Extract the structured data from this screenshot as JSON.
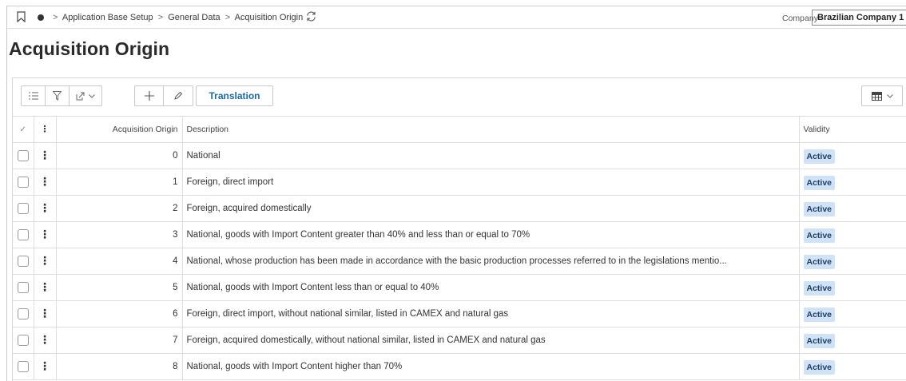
{
  "breadcrumb": {
    "items": [
      "Application Base Setup",
      "General Data",
      "Acquisition Origin"
    ]
  },
  "company": {
    "label": "Company",
    "value": "Brazilian Company 1"
  },
  "page": {
    "title": "Acquisition Origin"
  },
  "toolbar": {
    "translation_label": "Translation"
  },
  "table": {
    "headers": {
      "code": "Acquisition Origin",
      "description": "Description",
      "validity": "Validity"
    },
    "rows": [
      {
        "code": "0",
        "description": "National",
        "validity": "Active"
      },
      {
        "code": "1",
        "description": "Foreign, direct import",
        "validity": "Active"
      },
      {
        "code": "2",
        "description": "Foreign, acquired domestically",
        "validity": "Active"
      },
      {
        "code": "3",
        "description": "National, goods with Import Content greater than 40% and less than or equal to 70%",
        "validity": "Active"
      },
      {
        "code": "4",
        "description": "National, whose production has been made in accordance with the basic production processes referred to in the legislations mentio...",
        "validity": "Active"
      },
      {
        "code": "5",
        "description": "National, goods with Import Content less than or equal to 40%",
        "validity": "Active"
      },
      {
        "code": "6",
        "description": "Foreign, direct import, without national similar, listed in CAMEX and natural gas",
        "validity": "Active"
      },
      {
        "code": "7",
        "description": "Foreign, acquired domestically, without national similar, listed in CAMEX and natural gas",
        "validity": "Active"
      },
      {
        "code": "8",
        "description": "National, goods with Import Content higher than 70%",
        "validity": "Active"
      }
    ]
  },
  "colors": {
    "accent": "#1a6aa8",
    "badge_bg": "#cfe2f6",
    "badge_text": "#1d3f66"
  },
  "icons": [
    "bookmark-icon",
    "status-dot-icon",
    "refresh-icon",
    "list-icon",
    "filter-icon",
    "export-icon",
    "add-icon",
    "edit-icon",
    "table-view-icon",
    "chevron-down-icon",
    "checkmark-icon",
    "kebab-icon"
  ]
}
